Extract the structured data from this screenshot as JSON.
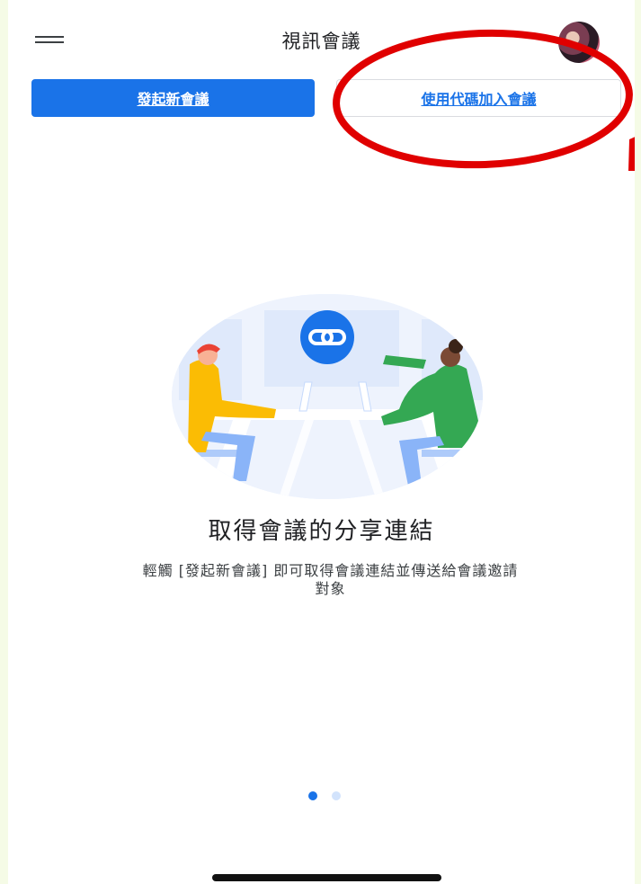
{
  "header": {
    "title": "視訊會議",
    "menu_icon": "menu-icon",
    "avatar_icon": "user-avatar"
  },
  "actions": {
    "start_meeting_label": "發起新會議",
    "join_with_code_label": "使用代碼加入會議"
  },
  "onboarding": {
    "heading": "取得會議的分享連結",
    "description_line1": "輕觸 [發起新會議] 即可取得會議連結並傳送給會議邀請",
    "description_line2": "對象",
    "illustration_icon": "link-icon",
    "page_indicator": {
      "total": 2,
      "active": 1
    }
  },
  "colors": {
    "primary": "#1a73e8",
    "annotation": "#e00000",
    "outer_background": "#f5fbe6"
  }
}
